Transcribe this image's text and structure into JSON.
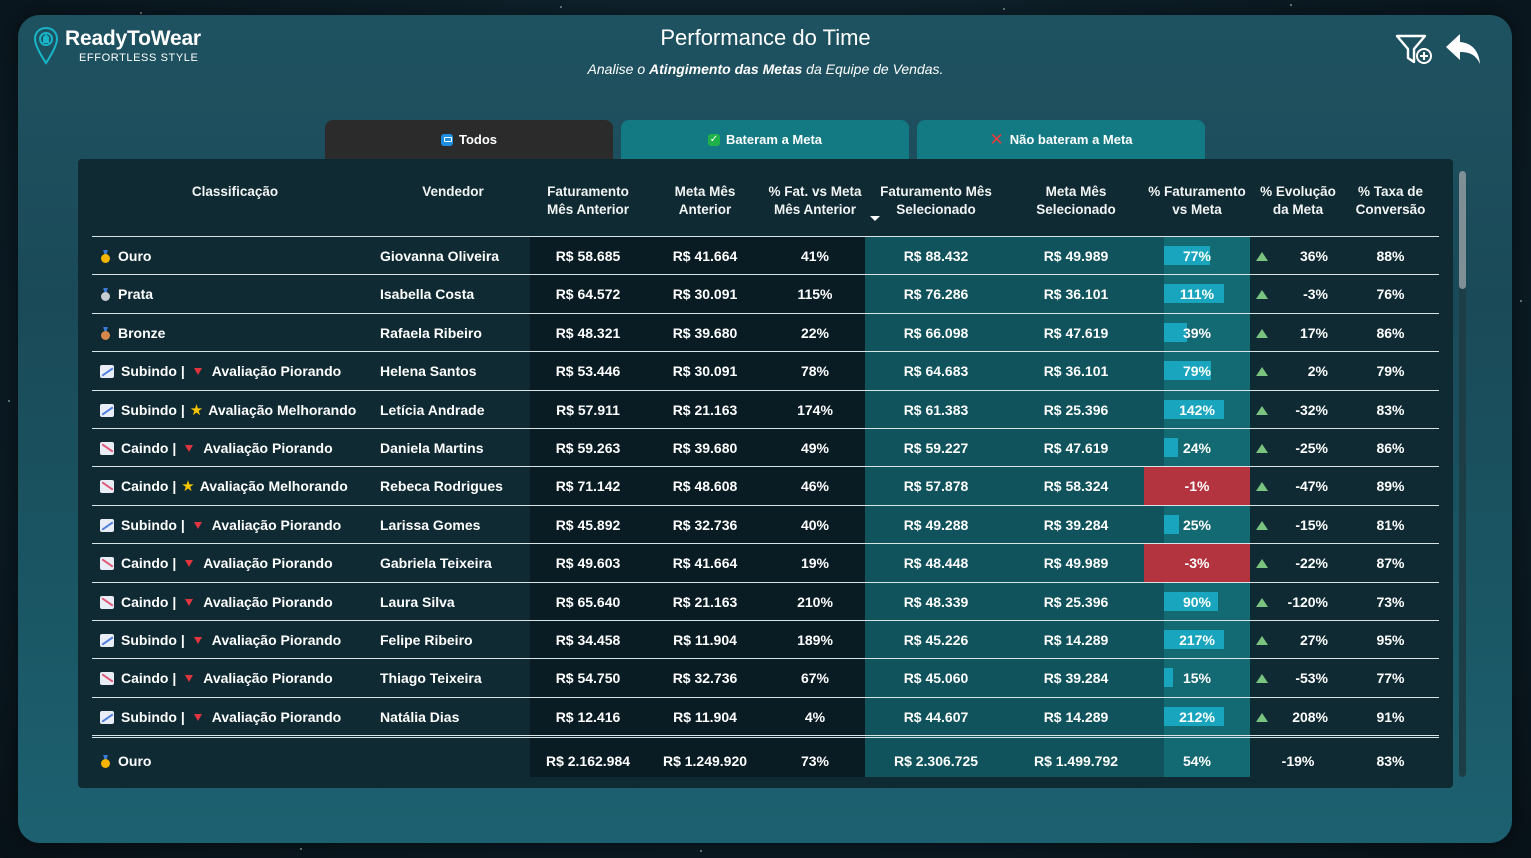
{
  "brand": {
    "name": "ReadyToWear",
    "tagline": "EFFORTLESS STYLE"
  },
  "header": {
    "title": "Performance do Time",
    "subtitle_pre": "Analise o ",
    "subtitle_bold": "Atingimento das Metas",
    "subtitle_post": " da Equipe de Vendas."
  },
  "icons": {
    "filter": "filter-add-icon",
    "back": "back-arrow-icon"
  },
  "tabs": [
    {
      "label": "Todos",
      "icon": "list-icon"
    },
    {
      "label": "Bateram a Meta",
      "icon": "check-icon"
    },
    {
      "label": "Não bateram a Meta",
      "icon": "x-icon"
    }
  ],
  "columns": [
    {
      "l1": "Classificação",
      "l2": ""
    },
    {
      "l1": "Vendedor",
      "l2": ""
    },
    {
      "l1": "Faturamento",
      "l2": "Mês Anterior"
    },
    {
      "l1": "Meta Mês",
      "l2": "Anterior"
    },
    {
      "l1": "% Fat. vs Meta",
      "l2": "Mês Anterior"
    },
    {
      "l1": "Faturamento Mês",
      "l2": "Selecionado"
    },
    {
      "l1": "Meta Mês",
      "l2": "Selecionado"
    },
    {
      "l1": "% Faturamento",
      "l2": "vs Meta"
    },
    {
      "l1": "% Evolução",
      "l2": "da Meta"
    },
    {
      "l1": "% Taxa de",
      "l2": "Conversão"
    }
  ],
  "rows": [
    {
      "kind": "medal",
      "medal": "gold",
      "class_label": "Ouro",
      "seller": "Giovanna Oliveira",
      "fat_ant": "R$ 58.685",
      "meta_ant": "R$ 41.664",
      "pct_ant": "41%",
      "fat_sel": "R$ 88.432",
      "meta_sel": "R$ 49.989",
      "pct_meta": "77%",
      "pct_meta_value": 0.77,
      "evol": "36%",
      "conv": "88%"
    },
    {
      "kind": "medal",
      "medal": "silver",
      "class_label": "Prata",
      "seller": "Isabella Costa",
      "fat_ant": "R$ 64.572",
      "meta_ant": "R$ 30.091",
      "pct_ant": "115%",
      "fat_sel": "R$ 76.286",
      "meta_sel": "R$ 36.101",
      "pct_meta": "111%",
      "pct_meta_value": 1.11,
      "evol": "-3%",
      "conv": "76%"
    },
    {
      "kind": "medal",
      "medal": "bronze",
      "class_label": "Bronze",
      "seller": "Rafaela Ribeiro",
      "fat_ant": "R$ 48.321",
      "meta_ant": "R$ 39.680",
      "pct_ant": "22%",
      "fat_sel": "R$ 66.098",
      "meta_sel": "R$ 47.619",
      "pct_meta": "39%",
      "pct_meta_value": 0.39,
      "evol": "17%",
      "conv": "86%"
    },
    {
      "kind": "trend",
      "trend": "up",
      "class_label": "Subindo |",
      "rating": "down",
      "rating_label": "Avaliação Piorando",
      "seller": "Helena Santos",
      "fat_ant": "R$ 53.446",
      "meta_ant": "R$ 30.091",
      "pct_ant": "78%",
      "fat_sel": "R$ 64.683",
      "meta_sel": "R$ 36.101",
      "pct_meta": "79%",
      "pct_meta_value": 0.79,
      "evol": "2%",
      "conv": "79%"
    },
    {
      "kind": "trend",
      "trend": "up",
      "class_label": "Subindo |",
      "rating": "star",
      "rating_label": "Avaliação Melhorando",
      "seller": "Letícia Andrade",
      "fat_ant": "R$ 57.911",
      "meta_ant": "R$ 21.163",
      "pct_ant": "174%",
      "fat_sel": "R$ 61.383",
      "meta_sel": "R$ 25.396",
      "pct_meta": "142%",
      "pct_meta_value": 1.42,
      "evol": "-32%",
      "conv": "83%"
    },
    {
      "kind": "trend",
      "trend": "down",
      "class_label": "Caindo |",
      "rating": "down",
      "rating_label": "Avaliação Piorando",
      "seller": "Daniela Martins",
      "fat_ant": "R$ 59.263",
      "meta_ant": "R$ 39.680",
      "pct_ant": "49%",
      "fat_sel": "R$ 59.227",
      "meta_sel": "R$ 47.619",
      "pct_meta": "24%",
      "pct_meta_value": 0.24,
      "evol": "-25%",
      "conv": "86%"
    },
    {
      "kind": "trend",
      "trend": "down",
      "class_label": "Caindo |",
      "rating": "star",
      "rating_label": "Avaliação Melhorando",
      "seller": "Rebeca Rodrigues",
      "fat_ant": "R$ 71.142",
      "meta_ant": "R$ 48.608",
      "pct_ant": "46%",
      "fat_sel": "R$ 57.878",
      "meta_sel": "R$ 58.324",
      "pct_meta": "-1%",
      "pct_meta_value": -0.01,
      "evol": "-47%",
      "conv": "89%"
    },
    {
      "kind": "trend",
      "trend": "up",
      "class_label": "Subindo |",
      "rating": "down",
      "rating_label": "Avaliação Piorando",
      "seller": "Larissa Gomes",
      "fat_ant": "R$ 45.892",
      "meta_ant": "R$ 32.736",
      "pct_ant": "40%",
      "fat_sel": "R$ 49.288",
      "meta_sel": "R$ 39.284",
      "pct_meta": "25%",
      "pct_meta_value": 0.25,
      "evol": "-15%",
      "conv": "81%"
    },
    {
      "kind": "trend",
      "trend": "down",
      "class_label": "Caindo |",
      "rating": "down",
      "rating_label": "Avaliação Piorando",
      "seller": "Gabriela Teixeira",
      "fat_ant": "R$ 49.603",
      "meta_ant": "R$ 41.664",
      "pct_ant": "19%",
      "fat_sel": "R$ 48.448",
      "meta_sel": "R$ 49.989",
      "pct_meta": "-3%",
      "pct_meta_value": -0.03,
      "evol": "-22%",
      "conv": "87%"
    },
    {
      "kind": "trend",
      "trend": "down",
      "class_label": "Caindo |",
      "rating": "down",
      "rating_label": "Avaliação Piorando",
      "seller": "Laura Silva",
      "fat_ant": "R$ 65.640",
      "meta_ant": "R$ 21.163",
      "pct_ant": "210%",
      "fat_sel": "R$ 48.339",
      "meta_sel": "R$ 25.396",
      "pct_meta": "90%",
      "pct_meta_value": 0.9,
      "evol": "-120%",
      "conv": "73%"
    },
    {
      "kind": "trend",
      "trend": "up",
      "class_label": "Subindo |",
      "rating": "down",
      "rating_label": "Avaliação Piorando",
      "seller": "Felipe Ribeiro",
      "fat_ant": "R$ 34.458",
      "meta_ant": "R$ 11.904",
      "pct_ant": "189%",
      "fat_sel": "R$ 45.226",
      "meta_sel": "R$ 14.289",
      "pct_meta": "217%",
      "pct_meta_value": 2.17,
      "evol": "27%",
      "conv": "95%"
    },
    {
      "kind": "trend",
      "trend": "down",
      "class_label": "Caindo |",
      "rating": "down",
      "rating_label": "Avaliação Piorando",
      "seller": "Thiago Teixeira",
      "fat_ant": "R$ 54.750",
      "meta_ant": "R$ 32.736",
      "pct_ant": "67%",
      "fat_sel": "R$ 45.060",
      "meta_sel": "R$ 39.284",
      "pct_meta": "15%",
      "pct_meta_value": 0.15,
      "evol": "-53%",
      "conv": "77%"
    },
    {
      "kind": "trend",
      "trend": "up",
      "class_label": "Subindo |",
      "rating": "down",
      "rating_label": "Avaliação Piorando",
      "seller": "Natália Dias",
      "fat_ant": "R$ 12.416",
      "meta_ant": "R$ 11.904",
      "pct_ant": "4%",
      "fat_sel": "R$ 44.607",
      "meta_sel": "R$ 14.289",
      "pct_meta": "212%",
      "pct_meta_value": 2.12,
      "evol": "208%",
      "conv": "91%"
    }
  ],
  "total": {
    "medal": "gold",
    "class_label": "Ouro",
    "fat_ant": "R$ 2.162.984",
    "meta_ant": "R$ 1.249.920",
    "pct_ant": "73%",
    "fat_sel": "R$ 2.306.725",
    "meta_sel": "R$ 1.499.792",
    "pct_meta": "54%",
    "evol": "-19%",
    "conv": "83%"
  },
  "colors": {
    "bar": "#18a5bd",
    "negative": "#b3333f",
    "up_arrow": "#7bc47f",
    "rating_down": "#e0353f",
    "star": "#f7c600"
  }
}
